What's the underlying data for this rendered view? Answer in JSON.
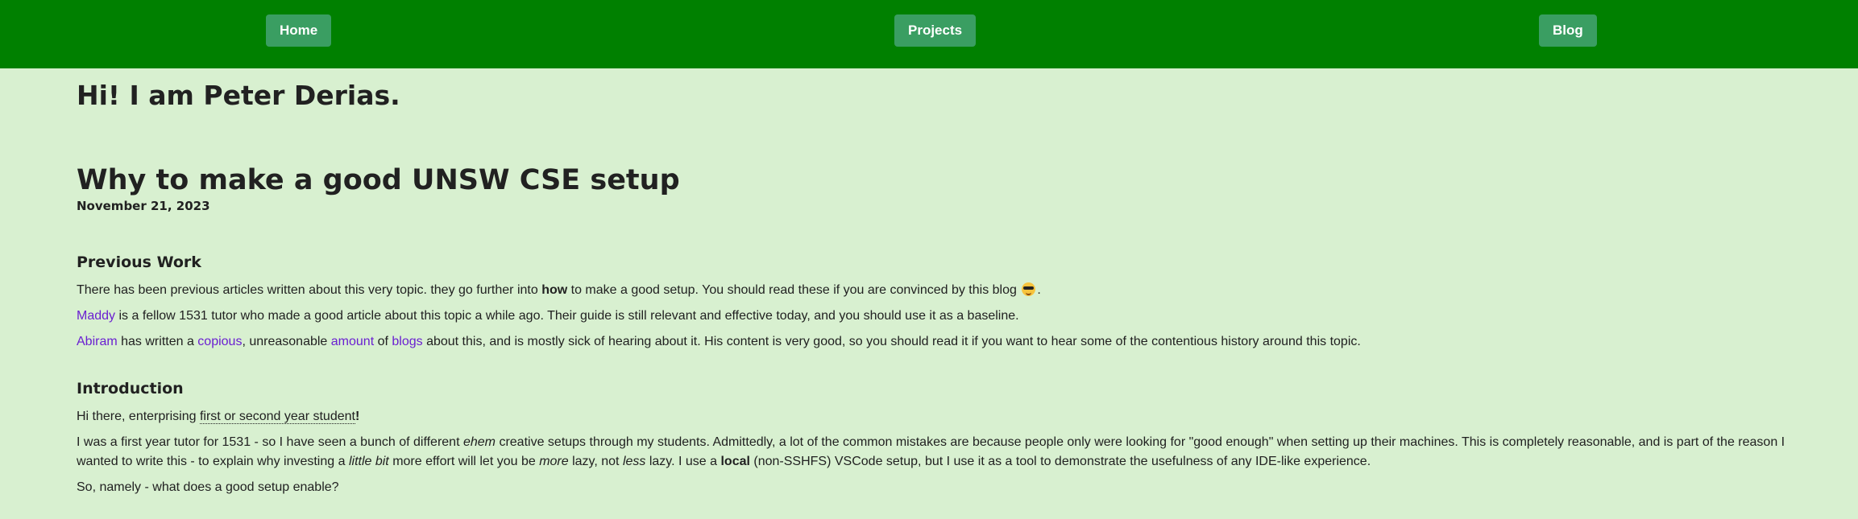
{
  "nav": {
    "home": "Home",
    "projects": "Projects",
    "blog": "Blog"
  },
  "site_title": "Hi! I am Peter Derias.",
  "post": {
    "title": "Why to make a good UNSW CSE setup",
    "date": "November 21, 2023"
  },
  "previous_work": {
    "heading": "Previous Work",
    "p1": {
      "before": "There has been previous articles written about this very topic. they go further into ",
      "bold": "how",
      "after": " to make a good setup. You should read these if you are convinced by this blog ",
      "emoji": "sunglasses-emoji",
      "end": "."
    },
    "p2": {
      "link": "Maddy",
      "text": " is a fellow 1531 tutor who made a good article about this topic a while ago. Their guide is still relevant and effective today, and you should use it as a baseline."
    },
    "p3": {
      "link_abiram": "Abiram",
      "t1": " has written a ",
      "link_copious": "copious",
      "t2": ", unreasonable ",
      "link_amount": "amount",
      "t3": " of ",
      "link_blogs": "blogs",
      "t4": " about this, and is mostly sick of hearing about it. His content is very good, so you should read it if you want to hear some of the contentious history around this topic."
    }
  },
  "introduction": {
    "heading": "Introduction",
    "p1": {
      "before": "Hi there, enterprising ",
      "abbr": "first or second year student",
      "after": "!"
    },
    "p2": {
      "t1": "I was a first year tutor for 1531 - so I have seen a bunch of different ",
      "em1": "ehem",
      "t2": " creative setups through my students. Admittedly, a lot of the common mistakes are because people only were looking for \"good enough\" when setting up their machines. This is completely reasonable, and is part of the reason I wanted to write this - to explain why investing a ",
      "em2": "little bit",
      "t3": " more effort will let you be ",
      "em3": "more",
      "t4": " lazy, not ",
      "em4": "less",
      "t5": " lazy. I use a ",
      "strong": "local",
      "t6": " (non-SSHFS) VSCode setup, but I use it as a tool to demonstrate the usefulness of any IDE-like experience."
    },
    "p3": "So, namely - what does a good setup enable?"
  },
  "colors": {
    "nav_bg": "#008000",
    "nav_button": "#3a9e62",
    "page_bg": "#d8f0d0",
    "link": "#6a1fd1"
  }
}
